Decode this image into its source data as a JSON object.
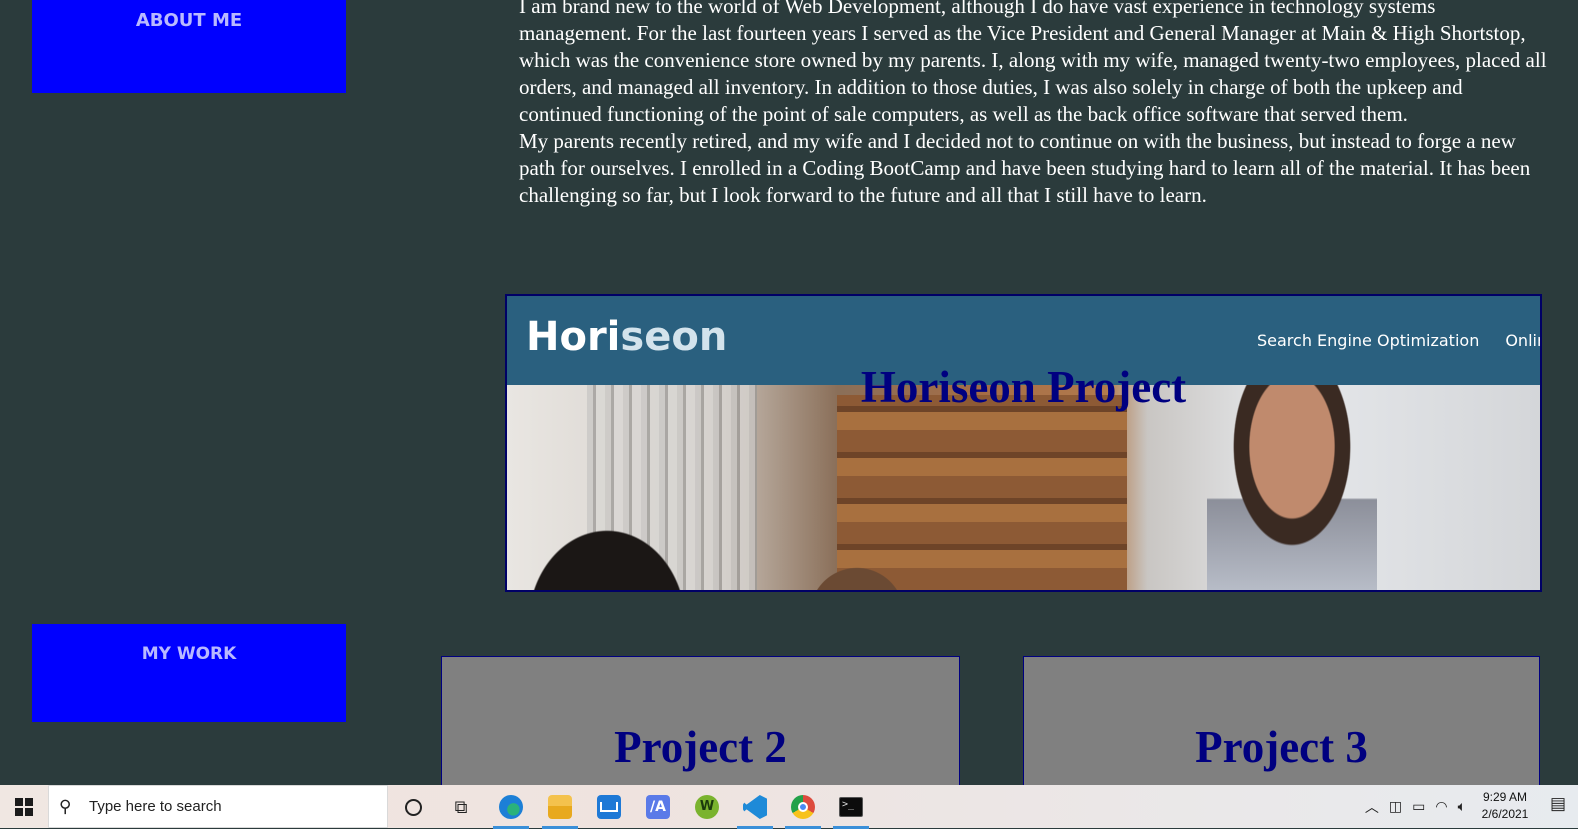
{
  "sidebar": {
    "about_label": "ABOUT ME",
    "work_label": "MY WORK"
  },
  "about": {
    "paragraph1": "I am brand new to the world of Web Development, although I do have vast experience in technology systems management. For the last fourteen years I served as the Vice President and General Manager at Main & High Shortstop, which was the convenience store owned by my parents. I, along with my wife, managed twenty-two employees, placed all orders, and managed all inventory. In addition to those duties, I was also solely in charge of both the upkeep and continued functioning of the point of sale computers, as well as the back office software that served them.",
    "paragraph2": "My parents recently retired, and my wife and I decided not to continue on with the business, but instead to forge a new path for ourselves. I enrolled in a Coding BootCamp and have been studying hard to learn all of the material. It has been challenging so far, but I look forward to the future and all that I still have to learn."
  },
  "projects": {
    "main": {
      "title": "Horiseon Project",
      "screenshot": {
        "logo_part1": "Hori",
        "logo_part2": "seon",
        "nav1": "Search Engine Optimization",
        "nav2": "Online"
      }
    },
    "p2_title": "Project 2",
    "p3_title": "Project 3"
  },
  "taskbar": {
    "search_placeholder": "Type here to search",
    "time": "9:29 AM",
    "date": "2/6/2021",
    "az_glyph": "/A",
    "w_glyph": "W",
    "term_glyph": ">_",
    "colors": {
      "accent": "#3a8fd8"
    }
  },
  "colors": {
    "background": "#2b3b3c",
    "nav_block": "#0000ff",
    "project_title": "#000080",
    "card": "#808080"
  }
}
